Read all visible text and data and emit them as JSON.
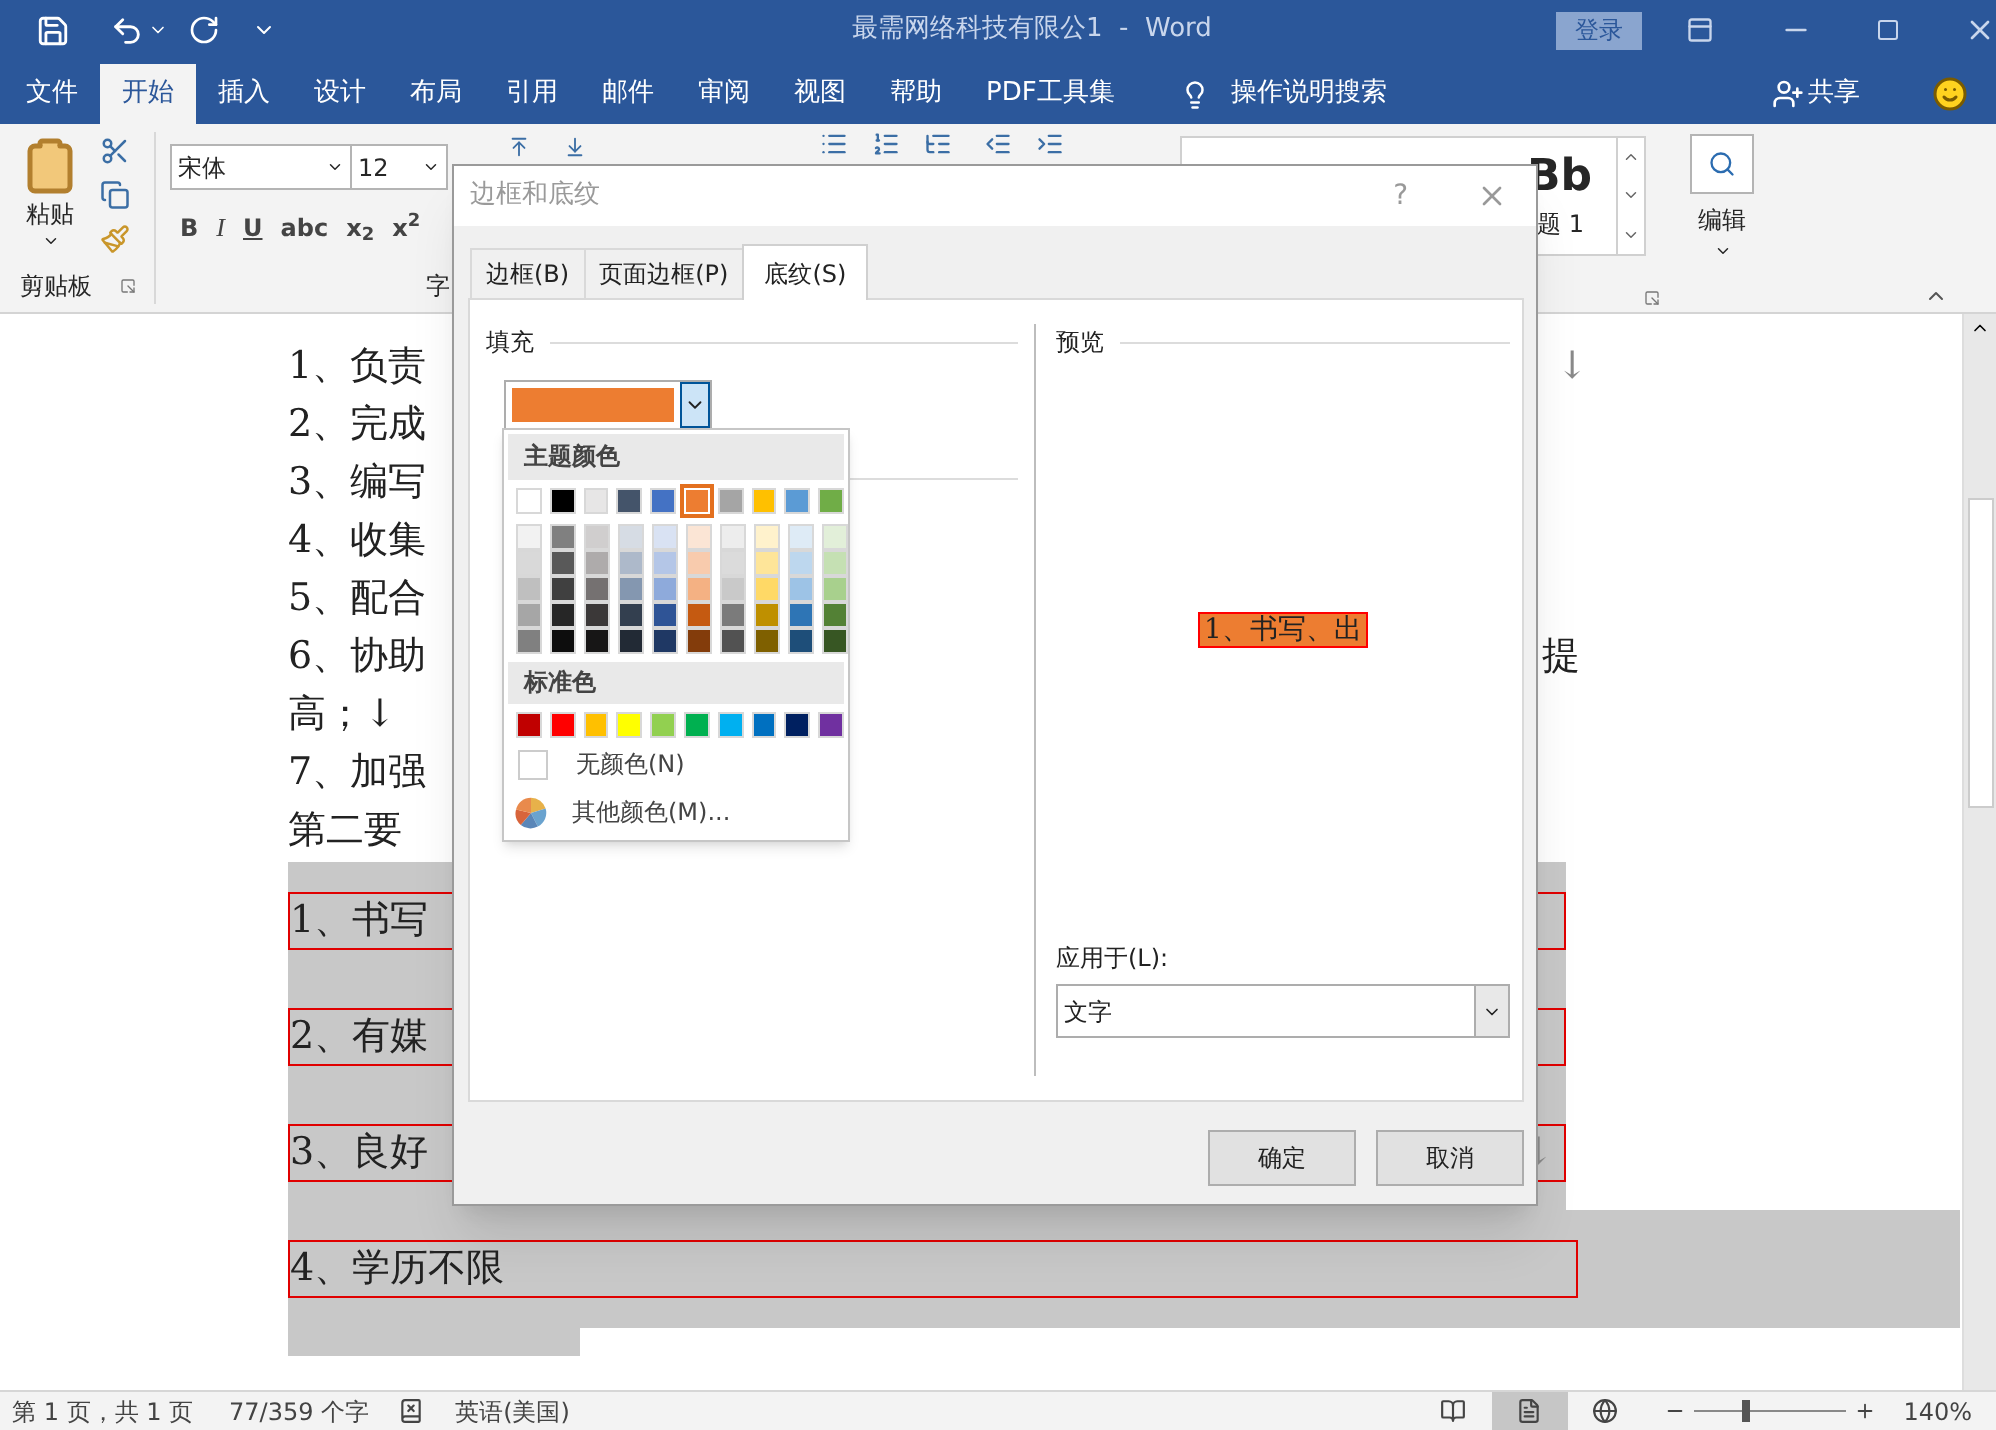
{
  "title_bar": {
    "title": "最需网络科技有限公1  -  Word",
    "sign_in": "登录"
  },
  "ribbon_tabs": [
    {
      "label": "文件",
      "selected": false
    },
    {
      "label": "开始",
      "selected": true
    },
    {
      "label": "插入",
      "selected": false
    },
    {
      "label": "设计",
      "selected": false
    },
    {
      "label": "布局",
      "selected": false
    },
    {
      "label": "引用",
      "selected": false
    },
    {
      "label": "邮件",
      "selected": false
    },
    {
      "label": "审阅",
      "selected": false
    },
    {
      "label": "视图",
      "selected": false
    },
    {
      "label": "帮助",
      "selected": false
    },
    {
      "label": "PDF工具集",
      "selected": false
    }
  ],
  "tell_me": "操作说明搜索",
  "share": "共享",
  "ribbon": {
    "paste": "粘贴",
    "clipboard_group": "剪贴板",
    "font_name": "宋体",
    "font_size": "12",
    "font_group": "字",
    "format_buttons": [
      "B",
      "I",
      "U",
      "abc",
      "x$_{2}$",
      "x$^{2}$"
    ],
    "style_sample": "Bb",
    "style_name": "题 1",
    "editing": "编辑"
  },
  "document": {
    "lines": [
      {
        "text": "1、负责",
        "end_mark": "↓"
      },
      {
        "text": "2、完成"
      },
      {
        "text": "3、编写"
      },
      {
        "text": "4、收集"
      },
      {
        "text": "5、配合"
      },
      {
        "text": "6、协助",
        "end_mark": "提"
      },
      {
        "text": "高；↓"
      },
      {
        "text": "7、加强"
      },
      {
        "text": "第二要"
      }
    ],
    "bordered_paragraphs": [
      {
        "text": "1、书写"
      },
      {
        "text": "2、有媒"
      },
      {
        "text": "3、良好",
        "end_mark": "↓"
      },
      {
        "text": "4、学历不限"
      }
    ]
  },
  "dialog": {
    "title": "边框和底纹",
    "help": "?",
    "tabs": [
      {
        "label": "边框(B)",
        "selected": false
      },
      {
        "label": "页面边框(P)",
        "selected": false
      },
      {
        "label": "底纹(S)",
        "selected": true
      }
    ],
    "fill_label": "填充",
    "fill": {
      "color": "#ed7d31"
    },
    "palette": {
      "theme_header": "主题颜色",
      "theme_colors": [
        {
          "color": "#ffffff",
          "selected": false,
          "shades": [
            {
              "color": "#f2f2f2",
              "selected": false
            },
            {
              "color": "#d9d9d9",
              "selected": false
            },
            {
              "color": "#bfbfbf",
              "selected": false
            },
            {
              "color": "#a6a6a6",
              "selected": false
            },
            {
              "color": "#808080",
              "selected": false
            }
          ]
        },
        {
          "color": "#000000",
          "selected": false,
          "shades": [
            {
              "color": "#808080",
              "selected": false
            },
            {
              "color": "#595959",
              "selected": false
            },
            {
              "color": "#404040",
              "selected": false
            },
            {
              "color": "#262626",
              "selected": false
            },
            {
              "color": "#0d0d0d",
              "selected": false
            }
          ]
        },
        {
          "color": "#e7e6e6",
          "selected": false,
          "shades": [
            {
              "color": "#d0cece",
              "selected": false
            },
            {
              "color": "#aeabab",
              "selected": false
            },
            {
              "color": "#757171",
              "selected": false
            },
            {
              "color": "#3b3838",
              "selected": false
            },
            {
              "color": "#171616",
              "selected": false
            }
          ]
        },
        {
          "color": "#44546a",
          "selected": false,
          "shades": [
            {
              "color": "#d6dce4",
              "selected": false
            },
            {
              "color": "#adb9ca",
              "selected": false
            },
            {
              "color": "#8497b0",
              "selected": false
            },
            {
              "color": "#333f4f",
              "selected": false
            },
            {
              "color": "#222a35",
              "selected": false
            }
          ]
        },
        {
          "color": "#4472c4",
          "selected": false,
          "shades": [
            {
              "color": "#d9e2f3",
              "selected": false
            },
            {
              "color": "#b4c6e7",
              "selected": false
            },
            {
              "color": "#8eaadb",
              "selected": false
            },
            {
              "color": "#2f5496",
              "selected": false
            },
            {
              "color": "#1f3864",
              "selected": false
            }
          ]
        },
        {
          "color": "#ed7d31",
          "selected": true,
          "shades": [
            {
              "color": "#fbe5d5",
              "selected": false
            },
            {
              "color": "#f8cbad",
              "selected": false
            },
            {
              "color": "#f4b183",
              "selected": false
            },
            {
              "color": "#c55a11",
              "selected": false
            },
            {
              "color": "#833c0b",
              "selected": false
            }
          ]
        },
        {
          "color": "#a5a5a5",
          "selected": false,
          "shades": [
            {
              "color": "#ededed",
              "selected": false
            },
            {
              "color": "#dbdbdb",
              "selected": false
            },
            {
              "color": "#c9c9c9",
              "selected": false
            },
            {
              "color": "#7b7b7b",
              "selected": false
            },
            {
              "color": "#525252",
              "selected": false
            }
          ]
        },
        {
          "color": "#ffc000",
          "selected": false,
          "shades": [
            {
              "color": "#fff2cc",
              "selected": false
            },
            {
              "color": "#fee599",
              "selected": false
            },
            {
              "color": "#ffd966",
              "selected": false
            },
            {
              "color": "#bf9000",
              "selected": false
            },
            {
              "color": "#7f6000",
              "selected": false
            }
          ]
        },
        {
          "color": "#5b9bd5",
          "selected": false,
          "shades": [
            {
              "color": "#deebf6",
              "selected": false
            },
            {
              "color": "#bdd7ee",
              "selected": false
            },
            {
              "color": "#9dc3e6",
              "selected": false
            },
            {
              "color": "#2e75b5",
              "selected": false
            },
            {
              "color": "#1e4e79",
              "selected": false
            }
          ]
        },
        {
          "color": "#70ad47",
          "selected": false,
          "shades": [
            {
              "color": "#e2efd9",
              "selected": false
            },
            {
              "color": "#c5e0b3",
              "selected": false
            },
            {
              "color": "#a8d08d",
              "selected": false
            },
            {
              "color": "#538135",
              "selected": false
            },
            {
              "color": "#375623",
              "selected": false
            }
          ]
        }
      ],
      "standard_header": "标准色",
      "standard_colors": [
        {
          "color": "#c00000",
          "selected": false
        },
        {
          "color": "#ff0000",
          "selected": false
        },
        {
          "color": "#ffc000",
          "selected": false
        },
        {
          "color": "#ffff00",
          "selected": false
        },
        {
          "color": "#92d050",
          "selected": false
        },
        {
          "color": "#00b050",
          "selected": false
        },
        {
          "color": "#00b0f0",
          "selected": false
        },
        {
          "color": "#0070c0",
          "selected": false
        },
        {
          "color": "#002060",
          "selected": false
        },
        {
          "color": "#7030a0",
          "selected": false
        }
      ],
      "no_color": "无颜色(N)",
      "more_colors": "其他颜色(M)..."
    },
    "preview_label": "预览",
    "preview_text": "1、书写、出",
    "apply_to_label": "应用于(L):",
    "apply_to": "文字",
    "ok": "确定",
    "cancel": "取消"
  },
  "status_bar": {
    "page": "第 1 页，共 1 页",
    "words": "77/359 个字",
    "language": "英语(美国)",
    "views": [
      {
        "kind": "read",
        "selected": false
      },
      {
        "kind": "print",
        "selected": true
      },
      {
        "kind": "web",
        "selected": false
      }
    ],
    "zoom": {
      "level": 0.32,
      "reading": "140%"
    }
  }
}
